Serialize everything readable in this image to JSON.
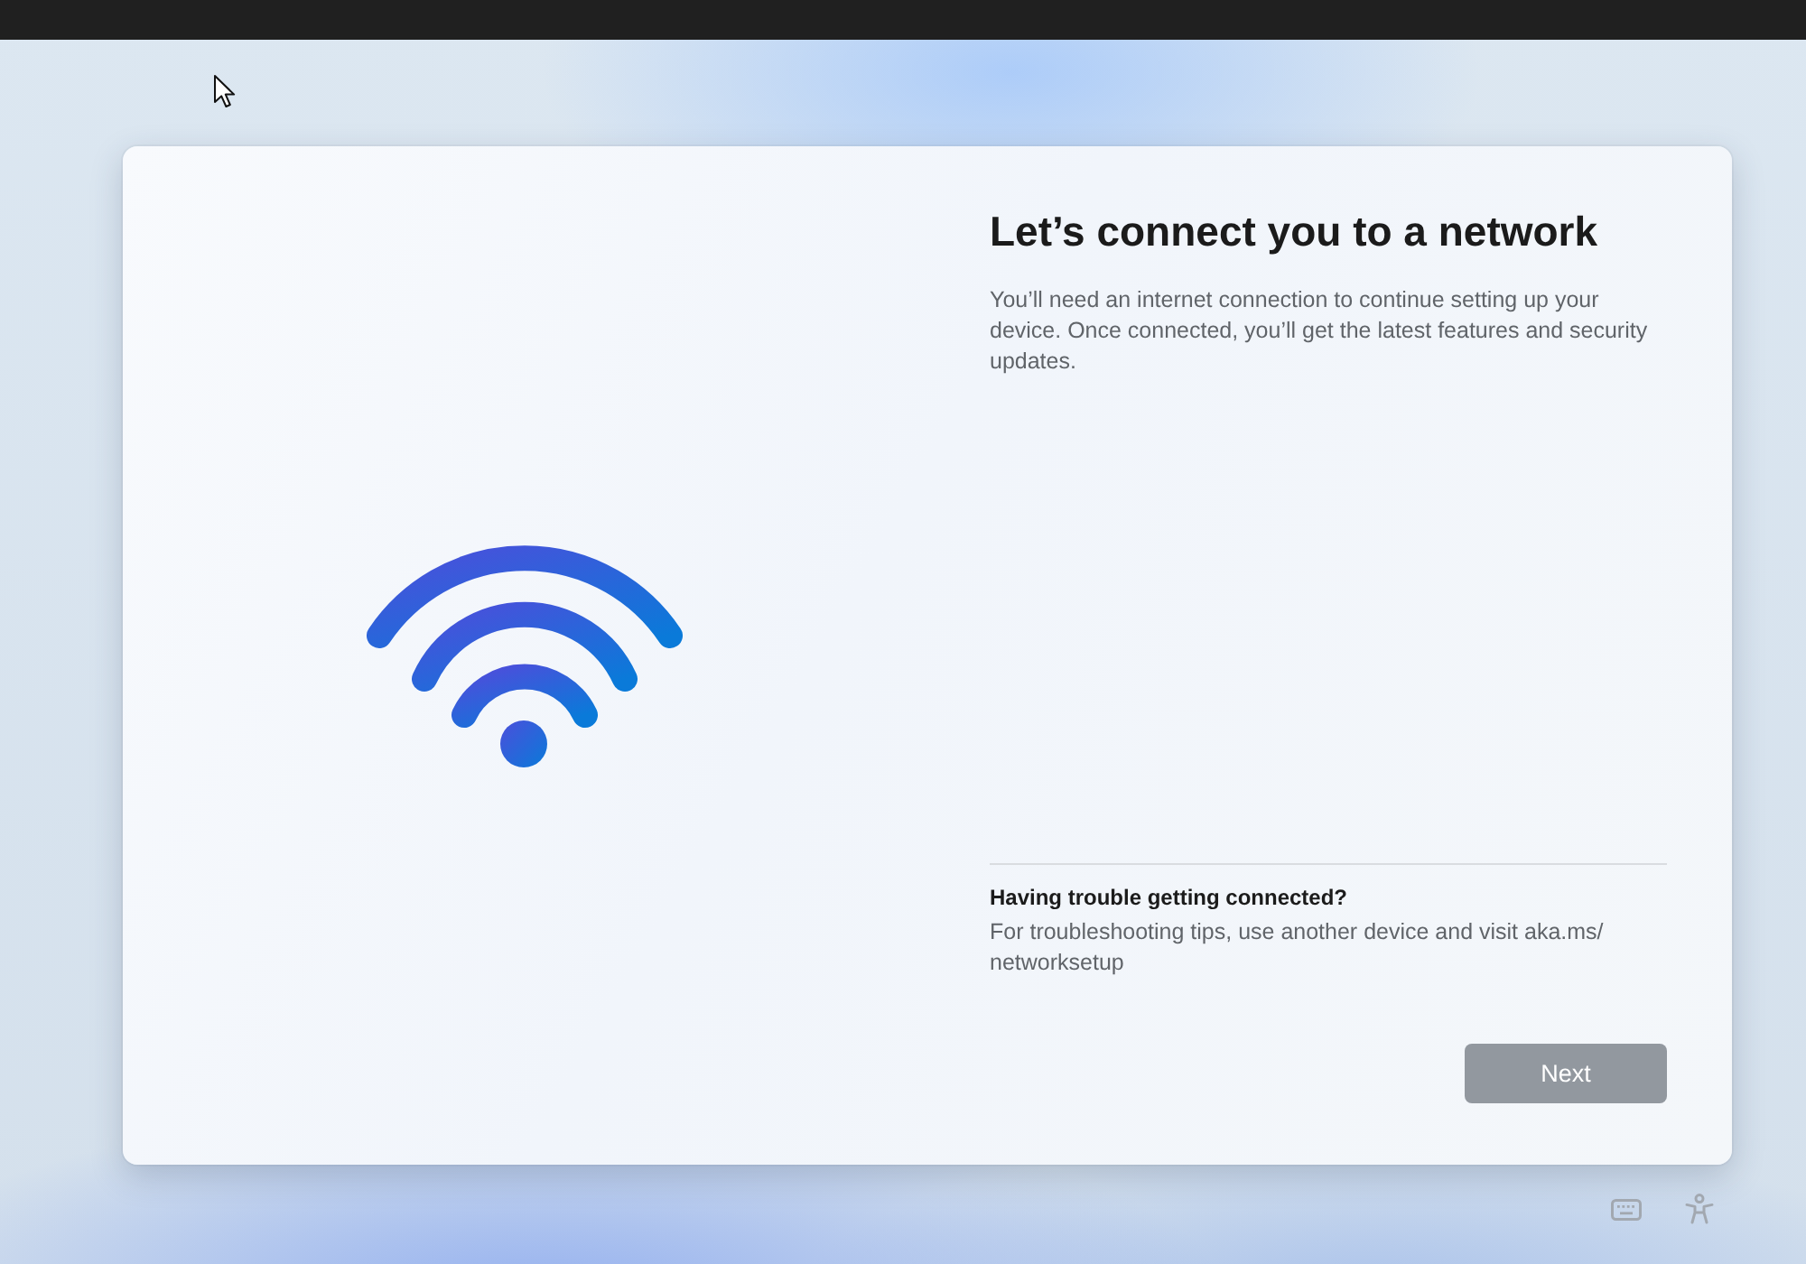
{
  "setup": {
    "title": "Let’s connect you to a network",
    "description": "You’ll need an internet connection to continue setting up your device. Once connected, you’ll get the latest features and security updates.",
    "help": {
      "heading": "Having trouble getting connected?",
      "text": "For troubleshooting tips, use another device and visit aka.ms/networksetup"
    },
    "next_button": {
      "label": "Next",
      "disabled": true
    }
  },
  "system_tray": [
    {
      "kind": "keyboard"
    },
    {
      "kind": "accessibility"
    }
  ]
}
